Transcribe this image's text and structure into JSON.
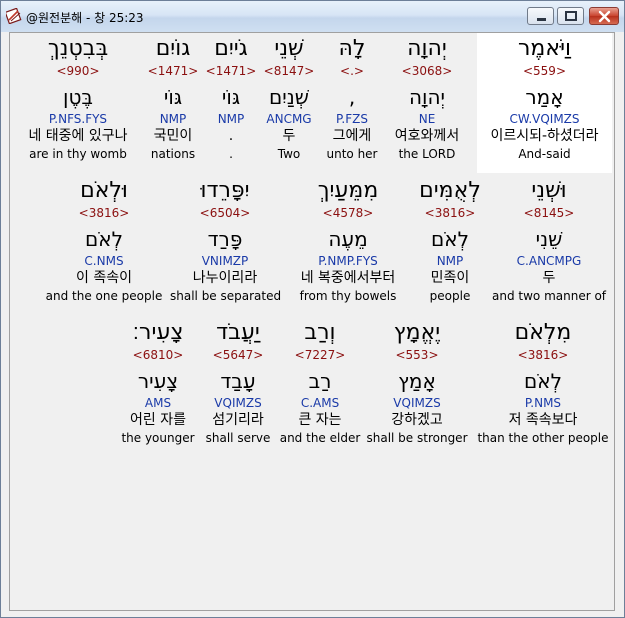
{
  "window": {
    "title": "@원전분해 - 창 25:23",
    "accent": "#1a3aa8",
    "strong_color": "#8b1010"
  },
  "rows": [
    {
      "words": [
        {
          "hebrew": "בְּבִטְנֵךְ",
          "strong": "<990>",
          "lemma": "בֶּטֶן",
          "morph": "P.NFS.FYS",
          "korean": "네 태중에 있구나",
          "english": "are in thy womb"
        },
        {
          "hebrew": "גוֹיִם",
          "strong": "<1471>",
          "lemma": "גּוֹי",
          "morph": "NMP",
          "korean": "국민이",
          "english": "nations"
        },
        {
          "hebrew": "גֹייִם",
          "strong": "<1471>",
          "lemma": "גּוֹי",
          "morph": "NMP",
          "korean": ".",
          "english": "."
        },
        {
          "hebrew": "שְׁנֵי",
          "strong": "<8147>",
          "lemma": "שְׁנַיִם",
          "morph": "ANCMG",
          "korean": "두",
          "english": "Two"
        },
        {
          "hebrew": "לָהּ",
          "strong": "<.>",
          "lemma": ",",
          "morph": "P.FZS",
          "korean": "그에게",
          "english": "unto her"
        },
        {
          "hebrew": "יְהוָה",
          "strong": "<3068>",
          "lemma": "יְהוָה",
          "morph": "NE",
          "korean": "여호와께서",
          "english": "the LORD"
        },
        {
          "hebrew": "וַיֹּאמֶר",
          "strong": "<559>",
          "lemma": "אָמַר",
          "morph": "CW.VQIMZS",
          "korean": "이르시되-하셨더라",
          "english": "And-said"
        }
      ]
    },
    {
      "words": [
        {
          "hebrew": "וּלְאֹם",
          "strong": "<3816>",
          "lemma": "לְאֹם",
          "morph": "C.NMS",
          "korean": "이 족속이",
          "english": "and the one people"
        },
        {
          "hebrew": "יִפָּרֵדוּ",
          "strong": "<6504>",
          "lemma": "פָּרַד",
          "morph": "VNIMZP",
          "korean": "나누이리라",
          "english": "shall be separated"
        },
        {
          "hebrew": "מִמֵּעַיִךְ",
          "strong": "<4578>",
          "lemma": "מֵעֶה",
          "morph": "P.NMP.FYS",
          "korean": "네 복중에서부터",
          "english": "from thy bowels"
        },
        {
          "hebrew": "לְאֻמִּים",
          "strong": "<3816>",
          "lemma": "לְאֹם",
          "morph": "NMP",
          "korean": "민족이",
          "english": "people"
        },
        {
          "hebrew": "וּשְׁנֵי",
          "strong": "<8145>",
          "lemma": "שֵׁנִי",
          "morph": "C.ANCMPG",
          "korean": "두",
          "english": "and two manner of"
        }
      ]
    },
    {
      "words": [
        {
          "hebrew": "צָעִיר׃",
          "strong": "<6810>",
          "lemma": "צָעִיר",
          "morph": "AMS",
          "korean": "어린 자를",
          "english": "the younger"
        },
        {
          "hebrew": "יַעֲבֹד",
          "strong": "<5647>",
          "lemma": "עָבַד",
          "morph": "VQIMZS",
          "korean": "섬기리라",
          "english": "shall serve"
        },
        {
          "hebrew": "וְרַב",
          "strong": "<7227>",
          "lemma": "רַב",
          "morph": "C.AMS",
          "korean": "큰 자는",
          "english": "and the elder"
        },
        {
          "hebrew": "יֶאֱמָץ",
          "strong": "<553>",
          "lemma": "אָמַץ",
          "morph": "VQIMZS",
          "korean": "강하겠고",
          "english": "shall be stronger"
        },
        {
          "hebrew": "מִלְאֹם",
          "strong": "<3816>",
          "lemma": "לְאֹם",
          "morph": "P.NMS",
          "korean": "저 족속보다",
          "english": "than the other people"
        }
      ]
    }
  ]
}
